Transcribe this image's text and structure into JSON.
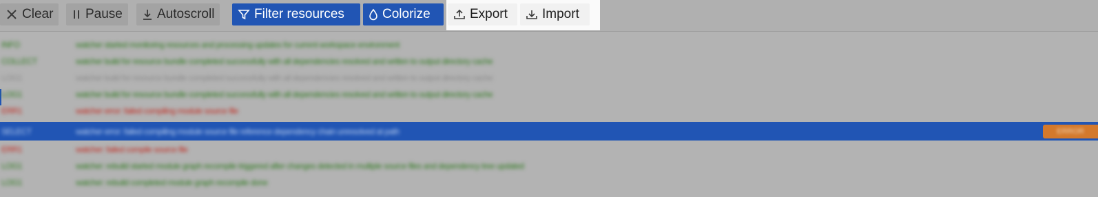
{
  "toolbar": {
    "clear_label": "Clear",
    "pause_label": "Pause",
    "autoscroll_label": "Autoscroll",
    "filter_label": "Filter resources",
    "colorize_label": "Colorize",
    "export_label": "Export",
    "import_label": "Import"
  },
  "colors": {
    "accent": "#2155b4",
    "success_text": "#2f7a1f",
    "error_text": "#c2281e",
    "muted_text": "#8b8b8b",
    "badge": "#d4792c"
  },
  "log": {
    "rows": [
      {
        "id": "INFO",
        "message": "watcher started monitoring resources and processing updates for current workspace environment",
        "tone": "green"
      },
      {
        "id": "COLLECT",
        "message": "watcher build for resource bundle completed successfully with all dependencies resolved and written to output directory cache",
        "tone": "green"
      },
      {
        "id": "LOG1",
        "message": "watcher build for resource bundle completed successfully with all dependencies resolved and written to output directory cache",
        "tone": "grey"
      },
      {
        "id": "LOG1",
        "message": "watcher build for resource bundle completed successfully with all dependencies resolved and written to output directory cache",
        "tone": "green"
      },
      {
        "id": "ERR1",
        "message": "watcher error: failed compiling module source file",
        "tone": "red"
      },
      {
        "id": "SELECT",
        "message": "watcher error: failed compiling module source file reference dependency chain unresolved at path",
        "tone": "white",
        "selected": true,
        "badge": "ERROR"
      },
      {
        "id": "ERR1",
        "message": "watcher: failed compile source file",
        "tone": "red"
      },
      {
        "id": "LOG1",
        "message": "watcher: rebuild started module graph recompile triggered after changes detected in multiple source files and dependency tree updated",
        "tone": "green"
      },
      {
        "id": "LOG1",
        "message": "watcher: rebuild completed module graph recompile done",
        "tone": "green"
      }
    ]
  }
}
